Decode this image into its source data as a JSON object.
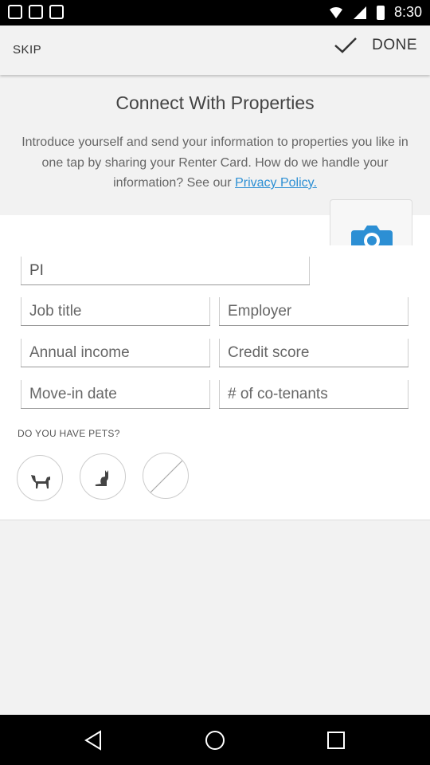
{
  "status_bar": {
    "time": "8:30"
  },
  "app_bar": {
    "skip_label": "SKIP",
    "done_label": "DONE"
  },
  "intro": {
    "title": "Connect With Properties",
    "body": "Introduce yourself and send your information to properties you like in one tap by sharing your Renter Card. How do we handle your information? See our ",
    "privacy_link": "Privacy Policy."
  },
  "form": {
    "name_value": "PI",
    "job_title_placeholder": "Job title",
    "employer_placeholder": "Employer",
    "annual_income_placeholder": "Annual income",
    "credit_score_placeholder": "Credit score",
    "move_in_date_placeholder": "Move-in date",
    "co_tenants_placeholder": "# of co-tenants",
    "pets_label": "DO YOU HAVE PETS?"
  },
  "icons": {
    "done": "checkmark-icon",
    "camera": "camera-icon",
    "dog": "dog-icon",
    "cat": "cat-icon",
    "no_pets": "no-pets-icon"
  },
  "colors": {
    "link": "#2c8fd4",
    "camera": "#2c8fd4"
  }
}
